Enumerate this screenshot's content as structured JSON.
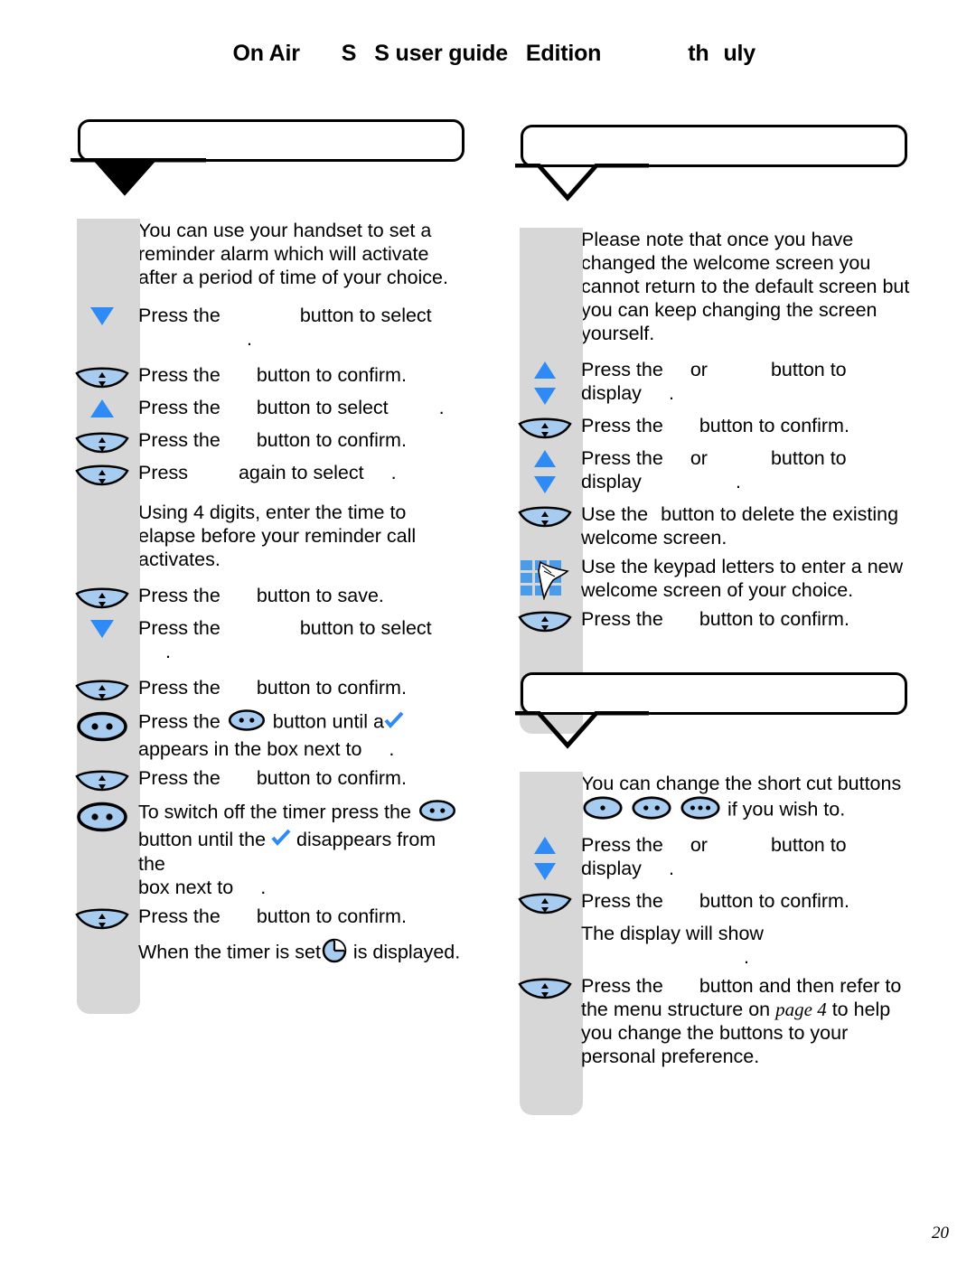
{
  "header": {
    "part1": "On Air",
    "part2": "S",
    "part3": "S user guide",
    "part4": "Edition",
    "part5": "th",
    "part6": "uly"
  },
  "page_number": "20",
  "left_column": {
    "callout_title": "",
    "intro": "You can use your handset to set a reminder alarm which will activate after a period of time of your choice.",
    "steps": [
      {
        "icon": "down-triangle-icon",
        "pre": "Press the",
        "mid": "button to select",
        "post": ""
      },
      {
        "icon": "rocker-button-icon",
        "pre": "Press the",
        "mid": "button to confirm.",
        "post": ""
      },
      {
        "icon": "up-triangle-icon",
        "pre": "Press the",
        "mid": "button to select",
        "post": "."
      },
      {
        "icon": "rocker-button-icon",
        "pre": "Press the",
        "mid": "button to confirm.",
        "post": ""
      },
      {
        "icon": "rocker-button-icon",
        "pre": "Press",
        "mid": "again to select",
        "post": "."
      }
    ],
    "digits_note": "Using 4 digits, enter the time to elapse before your reminder call activates.",
    "steps2": [
      {
        "icon": "rocker-button-icon",
        "pre": "Press the",
        "mid": "button to save.",
        "post": ""
      },
      {
        "icon": "down-triangle-icon",
        "pre": "Press the",
        "mid": "button to select",
        "post": ""
      },
      {
        "icon": "rocker-button-icon",
        "pre": "Press the",
        "mid": "button to confirm.",
        "post": ""
      }
    ],
    "check_step": {
      "icon": "two-dot-button-icon",
      "line1_a": "Press the",
      "line1_b": "button until a",
      "line2_a": "appears in the box next to",
      "line2_b": "."
    },
    "confirm_step": {
      "icon": "rocker-button-icon",
      "pre": "Press the",
      "mid": "button to confirm."
    },
    "switch_off_step": {
      "icon": "two-dot-button-icon",
      "line1": "To switch off the timer press the",
      "line2_a": "button until the",
      "line2_b": "disappears from the",
      "line3_a": "box next to",
      "line3_b": "."
    },
    "final_confirm": {
      "icon": "rocker-button-icon",
      "pre": "Press the",
      "mid": "button to confirm."
    },
    "timer_set_a": "When the timer is set",
    "timer_set_b": "is displayed."
  },
  "right_column": {
    "callout_title_1": "",
    "note": "Please note that once you have changed the welcome screen you cannot return to the default screen but you can keep changing the screen yourself.",
    "steps": [
      {
        "icon": "up-down-triangles-icon",
        "l1_a": "Press the",
        "l1_b": "or",
        "l1_c": "button to",
        "l2_a": "display",
        "l2_b": "."
      },
      {
        "icon": "rocker-button-icon",
        "pre": "Press the",
        "mid": "button to confirm."
      },
      {
        "icon": "up-down-triangles-icon",
        "l1_a": "Press the",
        "l1_b": "or",
        "l1_c": "button to",
        "l2_a": "display",
        "l2_b": "."
      },
      {
        "icon": "rocker-button-icon",
        "l1": "Use the",
        "l1_b": "button to delete the existing",
        "l2": "welcome screen."
      },
      {
        "icon": "keypad-hand-icon",
        "l1": "Use the keypad letters to enter a new",
        "l2": "welcome screen of your choice."
      },
      {
        "icon": "rocker-button-icon",
        "pre": "Press the",
        "mid": "button to confirm."
      }
    ],
    "callout_title_2": "",
    "shortcut_intro_a": "You can change the short cut buttons",
    "shortcut_intro_b": "if you wish to.",
    "steps2": [
      {
        "icon": "up-down-triangles-icon",
        "l1_a": "Press the",
        "l1_b": "or",
        "l1_c": "button to",
        "l2_a": "display",
        "l2_b": "."
      },
      {
        "icon": "rocker-button-icon",
        "pre": "Press the",
        "mid": "button to confirm."
      }
    ],
    "display_show_a": "The display will show",
    "display_show_b": ".",
    "menu_step": {
      "icon": "rocker-button-icon",
      "l1_a": "Press the",
      "l1_b": "button and then refer to",
      "l2_a": "the menu structure on",
      "l2_ref": "page 4",
      "l2_b": "to help",
      "l3": "you change the buttons to your",
      "l4": "personal preference."
    }
  },
  "colors": {
    "accent_blue": "#2E8BF5",
    "icon_fill_blue": "#A8CBF0",
    "strip_gray": "#D7D7D7",
    "outline_black": "#000000"
  },
  "icons": {
    "down_triangle": "down-triangle-icon",
    "up_triangle": "up-triangle-icon",
    "rocker_button": "rocker-button-icon",
    "two_dot_button": "two-dot-button-icon",
    "one_dot_button": "one-dot-button-icon",
    "three_dot_button": "three-dot-button-icon",
    "keypad_hand": "keypad-hand-icon",
    "clock": "clock-icon",
    "check": "check-icon"
  }
}
